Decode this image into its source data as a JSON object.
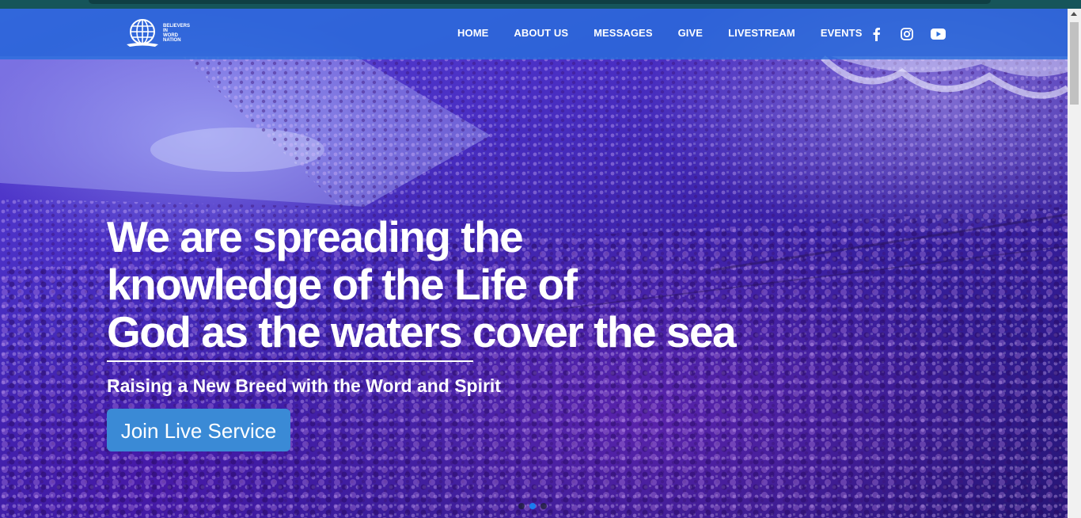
{
  "brand": {
    "logo_line1": "BELIEVERS",
    "logo_line2": "IN",
    "logo_line3": "WORD",
    "logo_line4": "NATION"
  },
  "nav": {
    "items": [
      {
        "label": "HOME"
      },
      {
        "label": "ABOUT US"
      },
      {
        "label": "MESSAGES"
      },
      {
        "label": "GIVE"
      },
      {
        "label": "LIVESTREAM"
      },
      {
        "label": "EVENTS"
      }
    ],
    "social": [
      "facebook-icon",
      "instagram-icon",
      "youtube-icon"
    ]
  },
  "hero": {
    "headline_line1": "We are spreading the",
    "headline_line2": "knowledge of the Life of",
    "headline_line3": "God as the waters cover the sea",
    "subtitle": "Raising a New Breed with the Word and Spirit",
    "cta_label": "Join Live Service",
    "slides_total": 3,
    "active_slide": 2
  },
  "colors": {
    "navbar": "#2a6edc",
    "cta": "#3a8ad6",
    "active_dot": "#1a7cf0"
  }
}
